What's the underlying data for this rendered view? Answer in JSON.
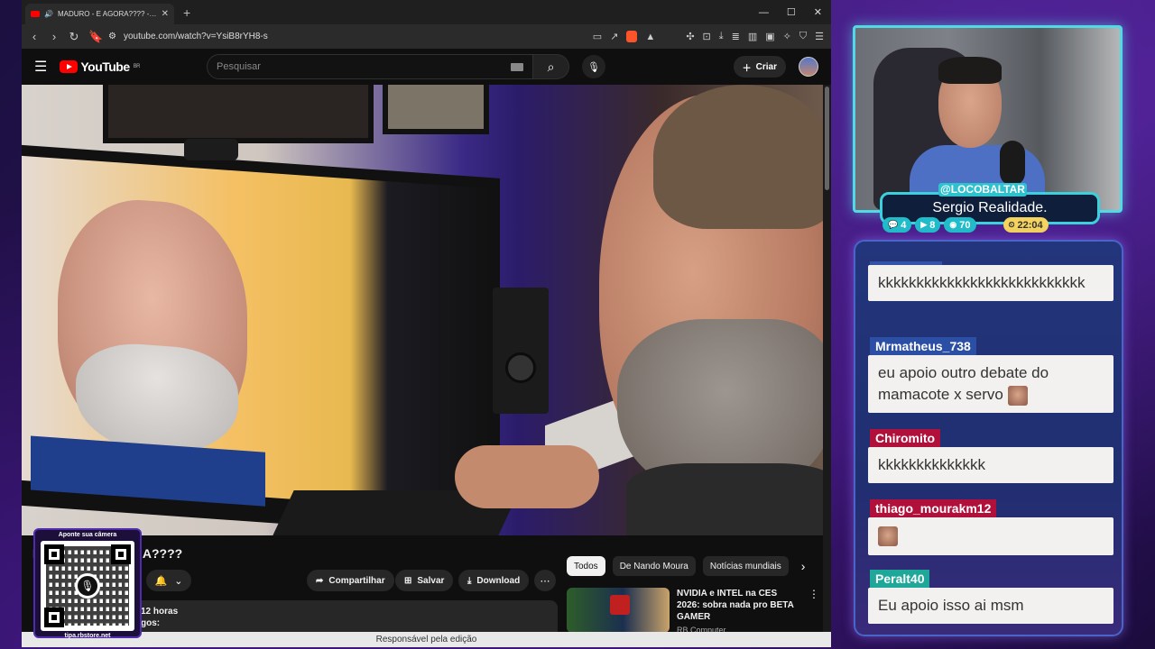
{
  "browser": {
    "tab_title": "MADURO - E AGORA???? - YouTube",
    "url": "youtube.com/watch?v=YsiB8rYH8-s",
    "status_text": "Responsável pela edição"
  },
  "youtube": {
    "logo_text": "YouTube",
    "region": "BR",
    "search_placeholder": "Pesquisar",
    "create_label": "Criar",
    "video_title_partial": "I",
    "video_title_end": "A????",
    "share_label": "Compartilhar",
    "save_label": "Salvar",
    "download_label": "Download",
    "desc_line1": "12 horas",
    "desc_line2": "gos:",
    "chips": [
      "Todos",
      "De Nando Moura",
      "Notícias mundiais"
    ],
    "recommended": {
      "title": "NVIDIA e INTEL na CES 2026: sobra nada pro BETA GAMER",
      "channel": "RB Computer"
    }
  },
  "qr": {
    "top_text": "Aponte sua câmera",
    "bottom_text": "tipa.rbstore.net"
  },
  "stream": {
    "handle": "@LOCOBALTAR",
    "banner": "Sergio Realidade.",
    "stats": [
      {
        "icon": "chat-icon",
        "value": "4"
      },
      {
        "icon": "video-icon",
        "value": "8"
      },
      {
        "icon": "coin-icon",
        "value": "70"
      },
      {
        "icon": "clock-icon",
        "value": "22:04"
      }
    ]
  },
  "chat": {
    "messages": [
      {
        "user": "",
        "text": "kkkkkkkkkkkkkkkkkkkkkkkkkkk",
        "color": "#3253a8"
      },
      {
        "user": "Mrmatheus_738",
        "text": "eu apoio outro debate do mamacote x servo",
        "color": "#2c4fa6"
      },
      {
        "user": "Chiromito",
        "text": "kkkkkkkkkkkkkk",
        "color": "#b0103a"
      },
      {
        "user": "thiago_mourakm12",
        "text": "",
        "color": "#b0103a"
      },
      {
        "user": "Peralt40",
        "text": "Eu apoio isso ai msm",
        "color": "#1fa79a"
      }
    ]
  }
}
